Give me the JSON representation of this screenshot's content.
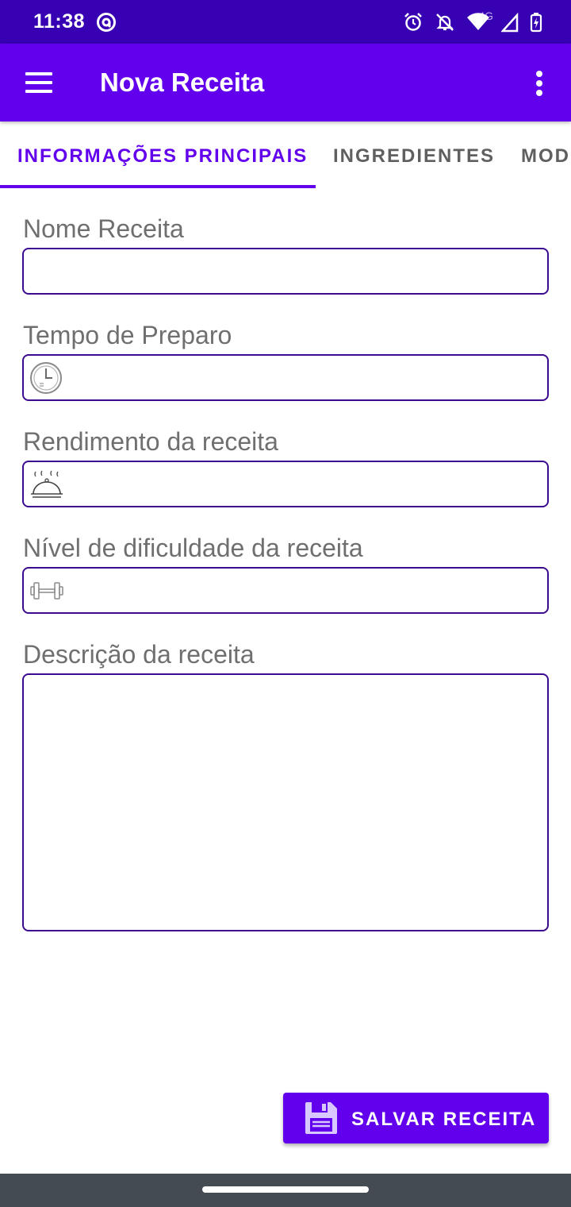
{
  "status_bar": {
    "time": "11:38",
    "network": "4G",
    "icons": [
      "at-sign-icon",
      "alarm-icon",
      "notifications-off-icon",
      "wifi-icon",
      "cell-signal-icon",
      "battery-charging-icon"
    ]
  },
  "app_bar": {
    "title": "Nova Receita",
    "menu_icon": "hamburger-menu-icon",
    "overflow_icon": "more-vert-icon"
  },
  "tabs": [
    {
      "label": "INFORMAÇÕES PRINCIPAIS",
      "active": true
    },
    {
      "label": "INGREDIENTES",
      "active": false
    },
    {
      "label": "MODO",
      "active": false
    }
  ],
  "form": {
    "name_label": "Nome Receita",
    "name_value": "",
    "prep_time_label": "Tempo de Preparo",
    "prep_time_value": "",
    "prep_time_icon": "clock-icon",
    "yield_label": "Rendimento da receita",
    "yield_value": "",
    "yield_icon": "serving-dish-icon",
    "difficulty_label": "Nível de dificuldade da receita",
    "difficulty_value": "",
    "difficulty_icon": "dumbbell-icon",
    "description_label": "Descrição da receita",
    "description_value": ""
  },
  "save_button": {
    "label": "SALVAR RECEITA",
    "icon": "floppy-disk-icon"
  },
  "colors": {
    "status_bar": "#3700b3",
    "app_bar": "#6200ee",
    "accent": "#6200ee",
    "field_border": "#3d0b8f",
    "label_text": "#6f6f6f",
    "nav_bar": "#444b52"
  }
}
